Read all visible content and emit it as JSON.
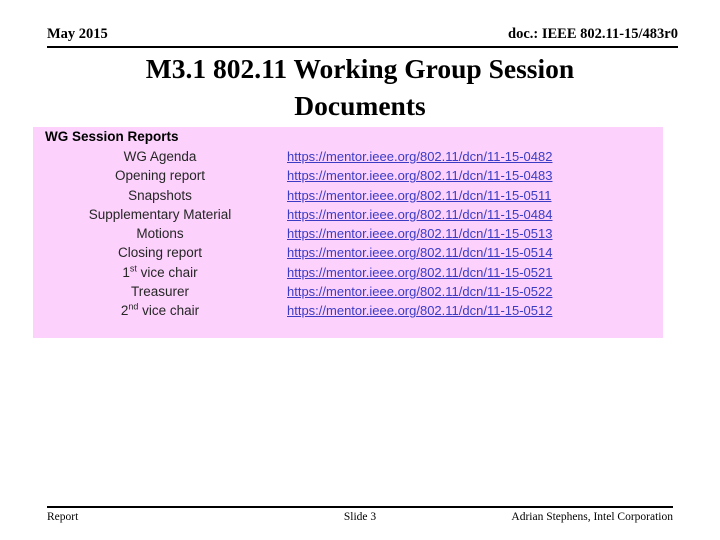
{
  "header": {
    "date": "May 2015",
    "doc": "doc.: IEEE 802.11-15/483r0"
  },
  "title": {
    "line1": "M3.1 802.11 Working Group Session",
    "line2": "Documents"
  },
  "content": {
    "section_header": "WG Session Reports",
    "rows": [
      {
        "label": "WG Agenda",
        "sup": "",
        "link": "https://mentor.ieee.org/802.11/dcn/11-15-0482"
      },
      {
        "label": "Opening report",
        "sup": "",
        "link": "https://mentor.ieee.org/802.11/dcn/11-15-0483"
      },
      {
        "label": "Snapshots",
        "sup": "",
        "link": "https://mentor.ieee.org/802.11/dcn/11-15-0511"
      },
      {
        "label": "Supplementary Material",
        "sup": "",
        "link": "https://mentor.ieee.org/802.11/dcn/11-15-0484"
      },
      {
        "label": "Motions",
        "sup": "",
        "link": "https://mentor.ieee.org/802.11/dcn/11-15-0513"
      },
      {
        "label": "Closing report",
        "sup": "",
        "link": "https://mentor.ieee.org/802.11/dcn/11-15-0514"
      },
      {
        "label": "1",
        "sup": "st",
        "label_suffix": " vice chair",
        "link": "https://mentor.ieee.org/802.11/dcn/11-15-0521"
      },
      {
        "label": "Treasurer",
        "sup": "",
        "link": "https://mentor.ieee.org/802.11/dcn/11-15-0522"
      },
      {
        "label": "2",
        "sup": "nd",
        "label_suffix": " vice chair",
        "link": "https://mentor.ieee.org/802.11/dcn/11-15-0512"
      }
    ]
  },
  "footer": {
    "left": "Report",
    "center": "Slide 3",
    "right": "Adrian Stephens, Intel Corporation"
  },
  "colors": {
    "block_background": "#fcd2fc",
    "link": "#3b3bc4",
    "text": "#262626",
    "rule": "#000000"
  }
}
